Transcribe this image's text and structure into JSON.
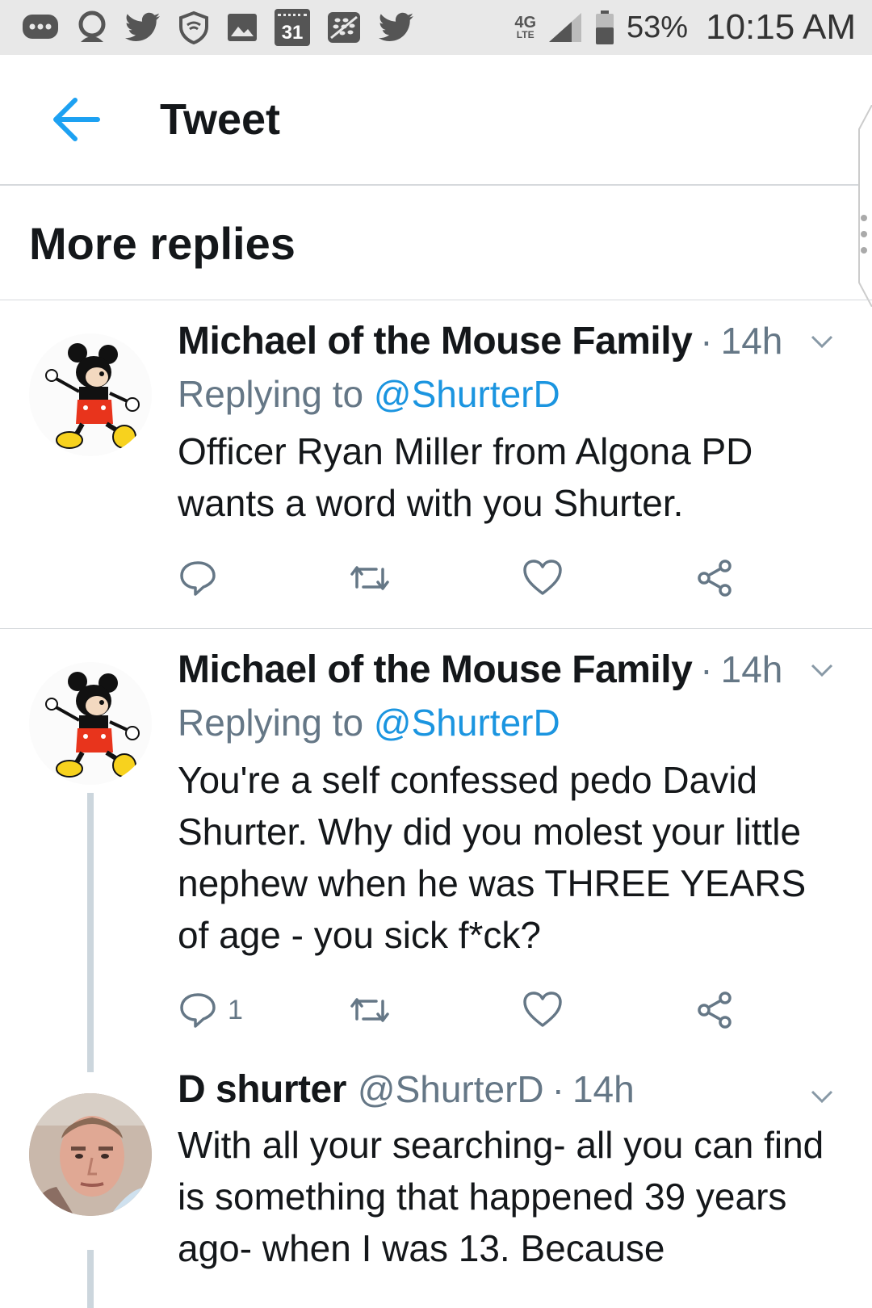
{
  "status_bar": {
    "icons": [
      "chat-bubble-icon",
      "person-icon",
      "twitter-bird-icon",
      "shield-icon",
      "gallery-icon",
      "calendar-icon",
      "blackberry-icon",
      "twitter-bird-icon"
    ],
    "calendar_day": "31",
    "network_type": "4G",
    "network_sub": "LTE",
    "battery": "53%",
    "time": "10:15 AM"
  },
  "header": {
    "title": "Tweet",
    "back_icon": "arrow-left-icon",
    "accent_color": "#1da1f2"
  },
  "section": {
    "title": "More replies"
  },
  "tweets": [
    {
      "author": "Michael of the Mouse Family",
      "handle": "",
      "separator": "·",
      "time": "14h",
      "replying_prefix": "Replying to",
      "replying_to": "@ShurterD",
      "body": "Officer Ryan Miller from Algona PD wants a word with you Shurter.",
      "reply_count": "",
      "avatar": "mickey-avatar"
    },
    {
      "author": "Michael of the Mouse Family",
      "handle": "",
      "separator": "·",
      "time": "14h",
      "replying_prefix": "Replying to",
      "replying_to": "@ShurterD",
      "body": "You're a self confessed pedo David Shurter. Why did you molest your little nephew when he was THREE YEARS of age - you sick f*ck?",
      "reply_count": "1",
      "avatar": "mickey-avatar"
    },
    {
      "author": "D shurter",
      "handle": "@ShurterD",
      "separator": "·",
      "time": "14h",
      "body": "With all your searching- all you can find is something that happened 39 years ago- when I was 13. Because",
      "avatar": "man-photo-avatar"
    }
  ]
}
